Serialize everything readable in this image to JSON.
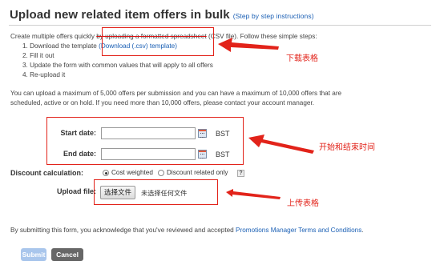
{
  "header": {
    "title": "Upload new related item offers in bulk",
    "instructions_link": "(Step by step instructions)"
  },
  "intro": {
    "line_start": "Create multiple offers quickly ",
    "line_strike": "by uploading a formatted spreadsheet",
    "line_end": " (CSV file). Follow these simple steps:",
    "steps": [
      {
        "prefix": "1. Download the template ",
        "link": "(Download (.csv) template)"
      },
      {
        "text": "2. Fill it out"
      },
      {
        "text": "3. Update the form with common values that will apply to all offers"
      },
      {
        "text": "4. Re-upload it"
      }
    ]
  },
  "limits": {
    "line1": "You can upload a maximum of 5,000 offers per submission and you can have a maximum of 10,000 offers that are",
    "line2": "scheduled, active or on hold. If you need more than 10,000 offers, please contact your account manager."
  },
  "form": {
    "start_label": "Start date:",
    "start_value": "",
    "end_label": "End date:",
    "end_value": "",
    "timezone": "BST",
    "discount_label": "Discount calculation:",
    "discount_options": [
      "Cost weighted",
      "Discount related only"
    ],
    "discount_selected": "Cost weighted",
    "help_text": "?",
    "upload_label": "Upload file:",
    "choose_file_button": "选择文件",
    "no_file_text": "未选择任何文件"
  },
  "annotations": {
    "download_template": "下载表格",
    "dates": "开始和结束时间",
    "upload": "上传表格"
  },
  "footer": {
    "agreement_prefix": "By submitting this form, you acknowledge that you've reviewed and accepted ",
    "agreement_link": "Promotions Manager Terms and Conditions",
    "agreement_suffix": "."
  },
  "buttons": {
    "submit": "Submit",
    "cancel": "Cancel"
  },
  "colors": {
    "link": "#1a5fb4",
    "annotation": "#e2231a",
    "submit_button": "#a9c6ec",
    "cancel_button": "#676767"
  }
}
